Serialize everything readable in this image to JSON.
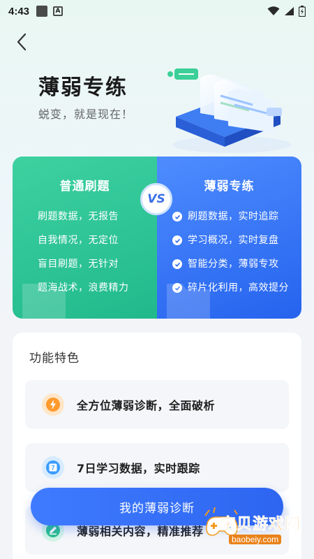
{
  "status_bar": {
    "time": "4:43"
  },
  "hero": {
    "title": "薄弱专练",
    "subtitle": "蜕变，就是现在！"
  },
  "compare": {
    "left": {
      "title": "普通刷题",
      "items": [
        "刷题数据，无报告",
        "自我情况，无定位",
        "盲目刷题，无针对",
        "题海战术，浪费精力"
      ]
    },
    "vs_label": "VS",
    "right": {
      "title": "薄弱专练",
      "items": [
        "刷题数据，实时追踪",
        "学习概况，实时复盘",
        "智能分类，薄弱专攻",
        "碎片化利用，高效提分"
      ]
    }
  },
  "features": {
    "title": "功能特色",
    "items": [
      {
        "text": "全方位薄弱诊断，全面破析",
        "icon": "lightning-icon",
        "color": "#ff9a2e"
      },
      {
        "text": "7日学习数据，实时跟踪",
        "icon": "calendar-7-icon",
        "color": "#3a9bff",
        "badge": "7"
      },
      {
        "text": "薄弱相关内容，精准推荐",
        "icon": "edit-icon",
        "color": "#2bbf8e"
      }
    ]
  },
  "cta": {
    "label": "我的薄弱诊断"
  },
  "watermark": {
    "text": "宝贝游戏网",
    "url": "baobeiy.com"
  }
}
